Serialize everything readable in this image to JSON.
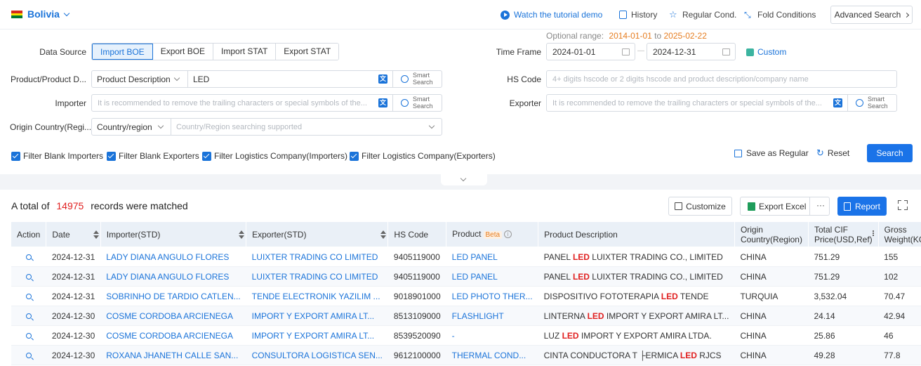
{
  "header": {
    "country": "Bolivia",
    "links": {
      "tutorial": "Watch the tutorial demo",
      "history": "History",
      "regular": "Regular Cond.",
      "fold": "Fold Conditions"
    },
    "advanced_search": "Advanced Search"
  },
  "form": {
    "data_source_label": "Data Source",
    "data_source_options": [
      "Import BOE",
      "Export BOE",
      "Import STAT",
      "Export STAT"
    ],
    "optional_range_label": "Optional range:",
    "optional_range_start": "2014-01-01",
    "optional_range_to": "to",
    "optional_range_end": "2025-02-22",
    "time_frame_label": "Time Frame",
    "time_start": "2024-01-01",
    "time_sep": "—",
    "time_end": "2024-12-31",
    "custom_label": "Custom",
    "product_label": "Product/Product D...",
    "product_select": "Product Description",
    "product_value": "LED",
    "smart_search_1": "Smart",
    "smart_search_2": "Search",
    "hs_label": "HS Code",
    "hs_placeholder": "4+ digits hscode or 2 digits hscode and product description/company name",
    "importer_label": "Importer",
    "importer_placeholder": "It is recommended to remove the trailing characters or special symbols of the...",
    "exporter_label": "Exporter",
    "exporter_placeholder": "It is recommended to remove the trailing characters or special symbols of the...",
    "origin_label": "Origin Country(Regi...",
    "origin_select": "Country/region",
    "origin_placeholder": "Country/Region searching supported",
    "checkboxes": [
      "Filter Blank Importers",
      "Filter Blank Exporters",
      "Filter Logistics Company(Importers)",
      "Filter Logistics Company(Exporters)"
    ],
    "save_regular": "Save as Regular",
    "reset": "Reset",
    "search": "Search"
  },
  "results": {
    "prefix": "A total of",
    "count": "14975",
    "suffix": "records were matched",
    "customize": "Customize",
    "export_excel": "Export Excel",
    "more": "···",
    "report": "Report"
  },
  "table": {
    "columns": {
      "action": "Action",
      "date": "Date",
      "importer": "Importer(STD)",
      "exporter": "Exporter(STD)",
      "hs": "HS Code",
      "product": "Product",
      "beta": "Beta",
      "description": "Product Description",
      "origin1": "Origin",
      "origin2": "Country(Region)",
      "cif1": "Total CIF",
      "cif2": "Price(USD,Ref)",
      "gross1": "Gross",
      "gross2": "Weight(KG)"
    },
    "rows": [
      {
        "date": "2024-12-31",
        "importer": "LADY DIANA ANGULO FLORES",
        "exporter": "LUIXTER TRADING CO LIMITED",
        "hs": "9405119000",
        "product": "LED PANEL",
        "desc_pre": "PANEL ",
        "desc_hl": "LED",
        "desc_post": " LUIXTER TRADING CO., LIMITED",
        "origin": "CHINA",
        "cif": "751.29",
        "gross": "155"
      },
      {
        "date": "2024-12-31",
        "importer": "LADY DIANA ANGULO FLORES",
        "exporter": "LUIXTER TRADING CO LIMITED",
        "hs": "9405119000",
        "product": "LED PANEL",
        "desc_pre": "PANEL ",
        "desc_hl": "LED",
        "desc_post": " LUIXTER TRADING CO., LIMITED",
        "origin": "CHINA",
        "cif": "751.29",
        "gross": "102"
      },
      {
        "date": "2024-12-31",
        "importer": "SOBRINHO DE TARDIO CATLEN...",
        "exporter": "TENDE ELECTRONIK YAZILIM ...",
        "hs": "9018901000",
        "product": "LED PHOTO THER...",
        "desc_pre": "DISPOSITIVO FOTOTERAPIA ",
        "desc_hl": "LED",
        "desc_post": " TENDE",
        "origin": "TURQUIA",
        "cif": "3,532.04",
        "gross": "70.47"
      },
      {
        "date": "2024-12-30",
        "importer": "COSME CORDOBA ARCIENEGA",
        "exporter": "IMPORT Y EXPORT AMIRA LT...",
        "hs": "8513109000",
        "product": "FLASHLIGHT",
        "desc_pre": "LINTERNA ",
        "desc_hl": "LED",
        "desc_post": " IMPORT Y EXPORT AMIRA LT...",
        "origin": "CHINA",
        "cif": "24.14",
        "gross": "42.94"
      },
      {
        "date": "2024-12-30",
        "importer": "COSME CORDOBA ARCIENEGA",
        "exporter": "IMPORT Y EXPORT AMIRA LT...",
        "hs": "8539520090",
        "product": "-",
        "desc_pre": "LUZ ",
        "desc_hl": "LED",
        "desc_post": " IMPORT Y EXPORT AMIRA LTDA.",
        "origin": "CHINA",
        "cif": "25.86",
        "gross": "46"
      },
      {
        "date": "2024-12-30",
        "importer": "ROXANA JHANETH CALLE SAN...",
        "exporter": "CONSULTORA LOGISTICA SEN...",
        "hs": "9612100000",
        "product": "THERMAL COND...",
        "desc_pre": "CINTA CONDUCTORA T ├ERMICA ",
        "desc_hl": "LED",
        "desc_post": " RJCS",
        "origin": "CHINA",
        "cif": "49.28",
        "gross": "77.8"
      }
    ]
  }
}
